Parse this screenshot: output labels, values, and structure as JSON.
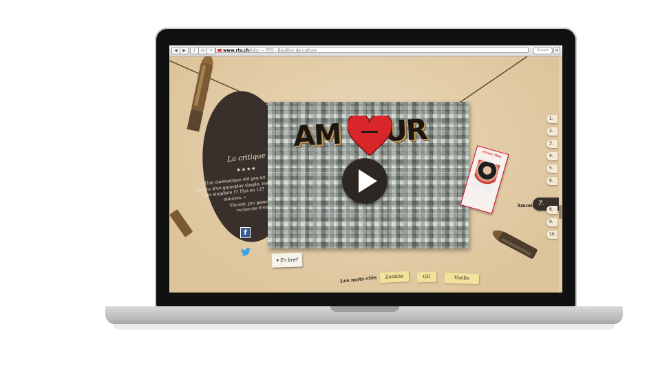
{
  "browser": {
    "url_domain": "www.rts.ch",
    "url_path": "/kdc/",
    "page_title": " — RTS - Bouillon de culture",
    "search_placeholder": "Google"
  },
  "critique": {
    "title": "La critique",
    "stars": "★★★★",
    "quote": "« Une cinématique old gen au service d'un gameplay simple, mais pas simpliste !!! Fini en 127 minutes. »",
    "author": "Vincent, pro gamer en recherche d'emploi"
  },
  "social": {
    "facebook_glyph": "f"
  },
  "video": {
    "title_left": "AM",
    "title_right": "UR",
    "heart_text": "O"
  },
  "en_bref": {
    "label": "▾ En bref"
  },
  "polaroid": {
    "title": "Amour Mag"
  },
  "tags": {
    "label": "Les mots-clés",
    "items": [
      "Zombie",
      "GG",
      "Vieille"
    ]
  },
  "nav": {
    "active_label": "Amour",
    "items": [
      "1.",
      "2.",
      "3.",
      "4.",
      "5.",
      "6.",
      "7.",
      "8.",
      "9.",
      "10."
    ]
  },
  "colors": {
    "page_bg": "#e9d7b7",
    "accent_red": "#d8262a",
    "dark_card": "#3a302b"
  }
}
